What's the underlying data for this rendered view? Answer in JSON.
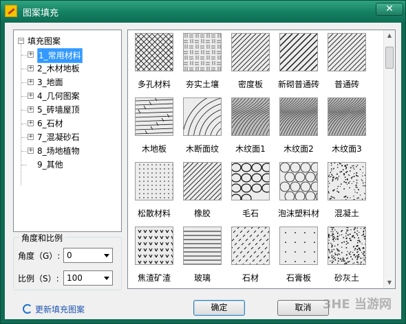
{
  "window": {
    "title": "图案填充",
    "close": "✕"
  },
  "tree": {
    "root": "填充图案",
    "items": [
      "1_常用材料",
      "2_木材地板",
      "3_地面",
      "4_几何图案",
      "5_砖墙屋顶",
      "6_石材",
      "7_混凝砂石",
      "8_场地植物",
      "9_其他"
    ],
    "selected_index": 0
  },
  "settings": {
    "group_title": "角度和比例",
    "angle_label": "角度（G）:",
    "angle_value": "0",
    "scale_label": "比例（S）:",
    "scale_value": "100"
  },
  "patterns": [
    "多孔材料",
    "夯实土壤",
    "密度板",
    "新砌普通砖",
    "普通砖",
    "木地板",
    "木断面纹",
    "木纹面1",
    "木纹面2",
    "木纹面3",
    "松散材料",
    "橡胶",
    "毛石",
    "泡沫塑料材",
    "混凝土",
    "焦渣矿渣",
    "玻璃",
    "石材",
    "石膏板",
    "砂灰土"
  ],
  "footer": {
    "refresh_link": "更新填充图案",
    "ok": "确定",
    "cancel": "取消",
    "watermark": "3HE 当游网"
  }
}
